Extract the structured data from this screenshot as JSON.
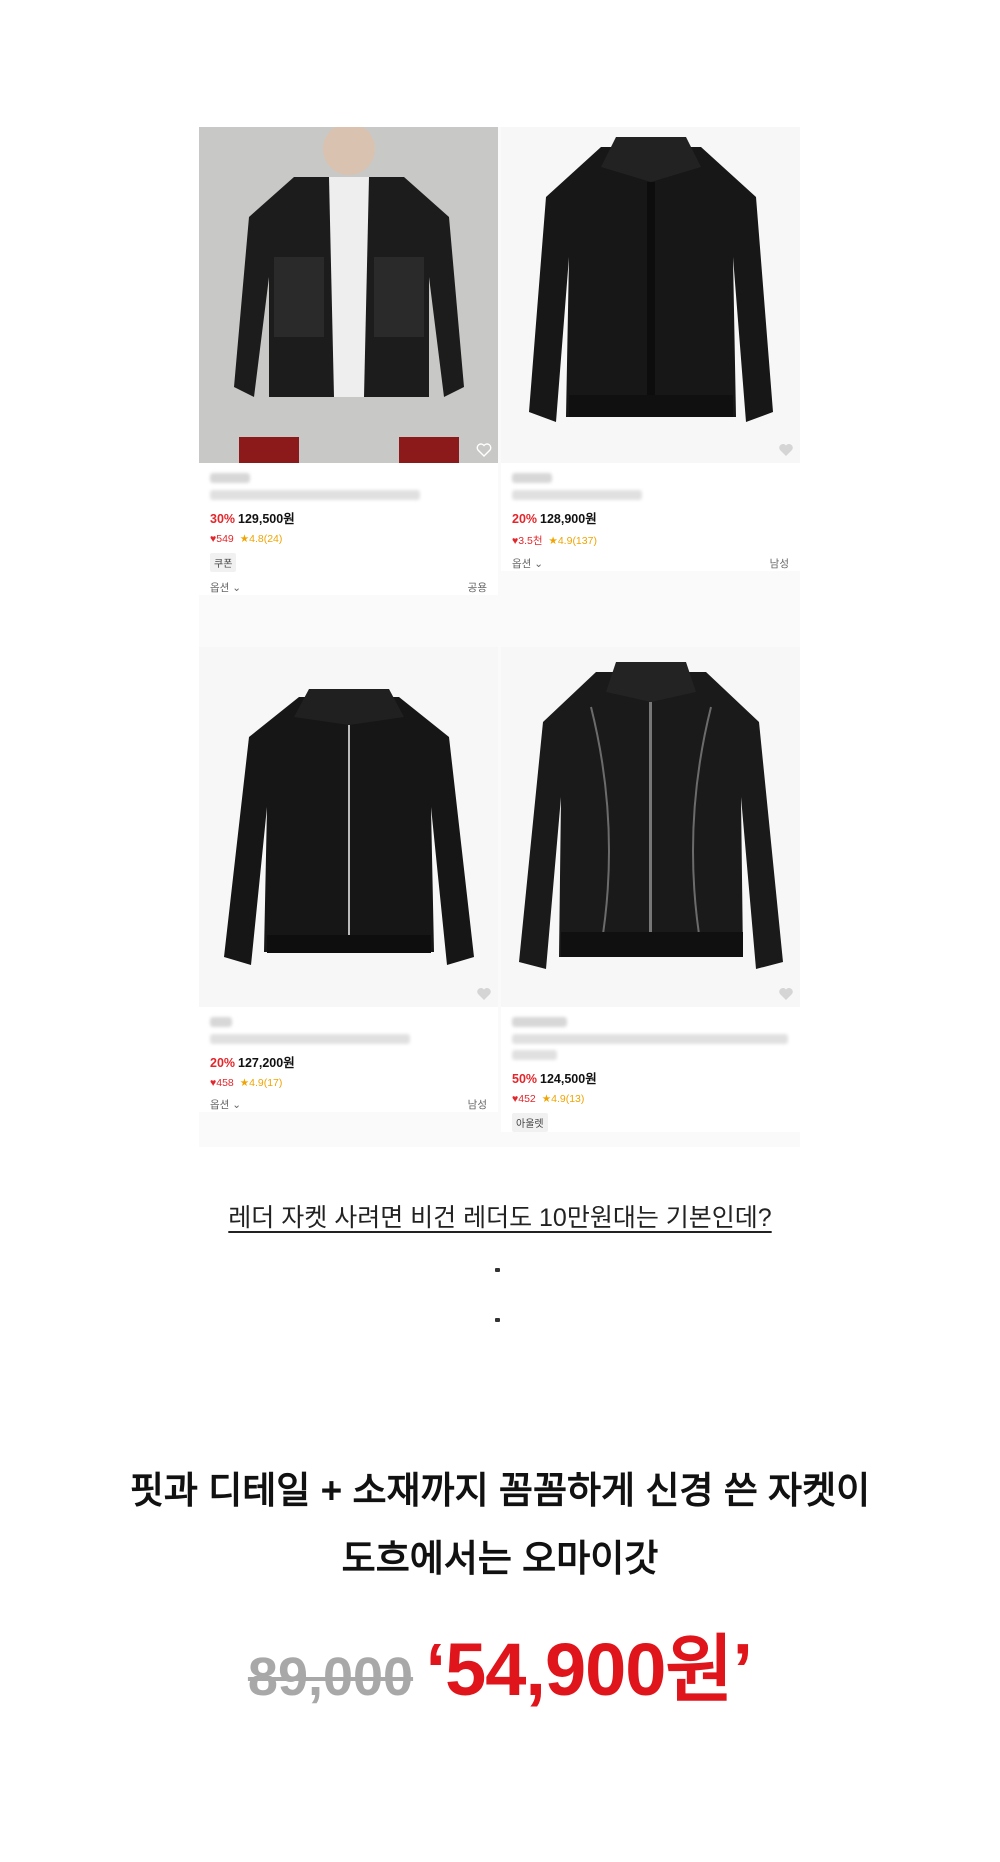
{
  "products": [
    {
      "price_discount": "30%",
      "price": "129,500원",
      "likes": "549",
      "rating": "4.8(24)",
      "tag": "쿠폰",
      "option_label": "옵션",
      "gender": "공용"
    },
    {
      "price_discount": "20%",
      "price": "128,900원",
      "likes": "3.5천",
      "rating": "4.9(137)",
      "option_label": "옵션",
      "gender": "남성"
    },
    {
      "price_discount": "20%",
      "price": "127,200원",
      "likes": "458",
      "rating": "4.9(17)",
      "option_label": "옵션",
      "gender": "남성"
    },
    {
      "price_discount": "50%",
      "price": "124,500원",
      "likes": "452",
      "rating": "4.9(13)",
      "tag": "아울렛"
    }
  ],
  "caption": "레더 자켓 사려면 비건 레더도 10만원대는 기본인데?",
  "headline_line1": "핏과 디테일 + 소재까지 꼼꼼하게 신경 쓴 자켓이",
  "headline_line2": "도흐에서는 오마이갓",
  "original_price": "89,000",
  "sale_price": "‘54,900원’",
  "colors": {
    "discount": "#e3262b",
    "sale_price": "#e0141b",
    "rating": "#f0a400"
  },
  "icons": [
    "heart-outline-icon",
    "heart-filled-icon",
    "star-icon",
    "chevron-down-icon"
  ]
}
